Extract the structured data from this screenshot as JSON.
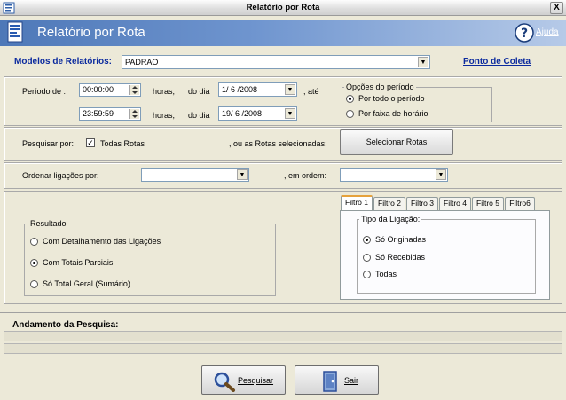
{
  "window": {
    "title": "Relatório por Rota",
    "close": "X"
  },
  "banner": {
    "title": "Relatório por Rota",
    "help": "Ajuda"
  },
  "modelos": {
    "label": "Modelos de Relatórios:",
    "value": "PADRAO",
    "ponto_link": "Ponto de Coleta"
  },
  "periodo": {
    "label": "Período de :",
    "row1": {
      "time": "00:00:00",
      "horas": "horas,",
      "do_dia": "do dia",
      "date": "1/ 6 /2008",
      "ate": ", até"
    },
    "row2": {
      "time": "23:59:59",
      "horas": "horas,",
      "do_dia": "do dia",
      "date": "19/ 6 /2008"
    }
  },
  "opcoes": {
    "title": "Opções do período",
    "options": [
      "Por todo o período",
      "Por faixa de horário"
    ],
    "selected": 0
  },
  "pesquisar": {
    "label": "Pesquisar por:",
    "todas": "Todas Rotas",
    "checked": true,
    "ou_label": ", ou as Rotas selecionadas:",
    "button": "Selecionar Rotas"
  },
  "ordenar": {
    "label": "Ordenar ligações por:",
    "ordem_label": ", em ordem:",
    "value1": "",
    "value2": ""
  },
  "resultado": {
    "title": "Resultado",
    "options": [
      "Com Detalhamento das Ligações",
      "Com Totais  Parciais",
      "Só Total  Geral (Sumário)"
    ],
    "selected": 1
  },
  "tabs": [
    "Filtro 1",
    "Filtro 2",
    "Filtro 3",
    "Filtro 4",
    "Filtro 5",
    "Filtro6"
  ],
  "tab_active": 0,
  "tipo": {
    "title": "Tipo da Ligação:",
    "options": [
      "Só Originadas",
      "Só Recebidas",
      "Todas"
    ],
    "selected": 0
  },
  "andamento": {
    "label": "Andamento da Pesquisa:"
  },
  "actions": {
    "pesquisar": "Pesquisar",
    "sair": "Sair"
  }
}
